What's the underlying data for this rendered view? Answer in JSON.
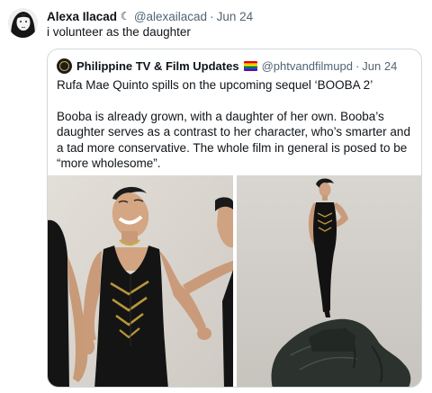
{
  "tweet": {
    "author_name": "Alexa Ilacad",
    "author_symbol": "☾",
    "handle": "@alexailacad",
    "separator": "·",
    "date": "Jun 24",
    "text": "i volunteer as the daughter"
  },
  "quote": {
    "author_name": "Philippine TV & Film Updates",
    "flag_icon": "rainbow-flag-icon",
    "handle": "@phtvandfilmupd",
    "separator": "·",
    "date": "Jun 24",
    "line1": "Rufa Mae Quinto spills on the upcoming sequel ‘BOOBA 2’",
    "line2": "Booba is already grown, with a daughter of her own. Booba’s daughter serves as a contrast to her character, who’s smarter and a tad more conservative. The whole film in general is posed to be “more wholesome”."
  },
  "colors": {
    "text_primary": "#0f1419",
    "text_secondary": "#536471",
    "border": "#cfd9de",
    "dress": "#141414",
    "gold_trim": "#b8963c"
  }
}
